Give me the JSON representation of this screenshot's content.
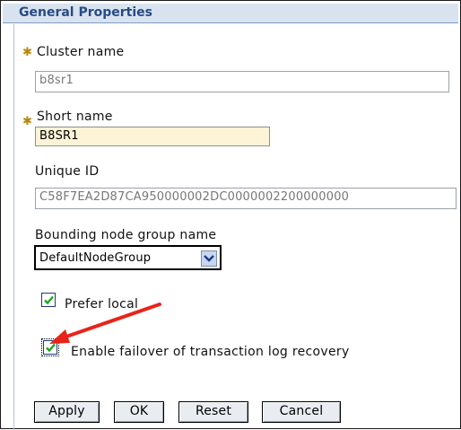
{
  "section": {
    "title": "General Properties"
  },
  "cluster_name": {
    "label": "Cluster name",
    "value": "b8sr1",
    "required": true
  },
  "short_name": {
    "label": "Short name",
    "value": "B8SR1",
    "required": true
  },
  "unique_id": {
    "label": "Unique ID",
    "value": "C58F7EA2D87CA950000002DC0000002200000000"
  },
  "bounding_node_group": {
    "label": "Bounding node group name",
    "selected": "DefaultNodeGroup"
  },
  "prefer_local": {
    "label": "Prefer local",
    "checked": true
  },
  "enable_failover": {
    "label": "Enable failover of transaction log recovery",
    "checked": true
  },
  "buttons": {
    "apply": "Apply",
    "ok": "OK",
    "reset": "Reset",
    "cancel": "Cancel"
  },
  "colors": {
    "header_bg": "#d9e3ef",
    "header_text": "#274b84",
    "check_green": "#1fa31f",
    "annotation_arrow": "#e8231a"
  },
  "icons": {
    "required": "asterisk-icon",
    "dropdown": "chevron-down-icon",
    "check": "checkmark-icon",
    "annotation": "red-arrow-icon"
  }
}
